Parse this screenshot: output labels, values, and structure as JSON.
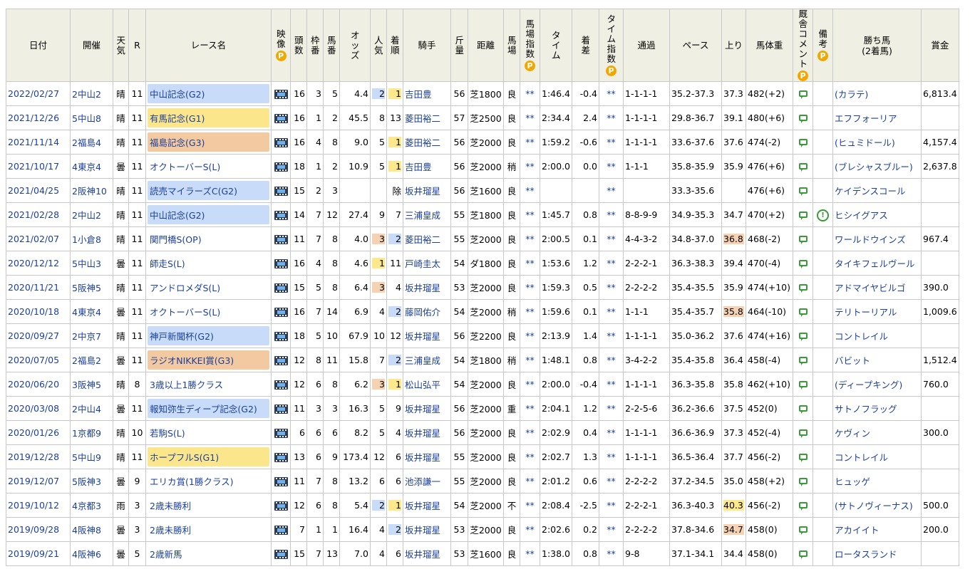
{
  "headers": {
    "date": "日付",
    "venue": "開催",
    "weather": "天気",
    "r": "R",
    "race_name": "レース名",
    "video": "映像",
    "field": "頭数",
    "frame": "枠番",
    "horse_no": "馬番",
    "odds": "オッズ",
    "pop": "人気",
    "rank": "着順",
    "jockey": "騎手",
    "weight": "斤量",
    "distance": "距離",
    "track": "馬場",
    "track_index": "馬場指数",
    "time": "タイム",
    "margin": "着差",
    "time_index": "タイム指数",
    "passing": "通過",
    "pace": "ペース",
    "last3f": "上り",
    "body_weight": "馬体重",
    "stable_comment": "厩舎コメント",
    "remarks": "備考",
    "winner": "勝ち馬",
    "winner_sub": "(2着馬)",
    "prize": "賞金",
    "premium_icon": "P"
  },
  "rows": [
    {
      "date": "2022/02/27",
      "venue": "2中山2",
      "weather": "晴",
      "r": "11",
      "race": "中山記念(G2)",
      "grade": "g2",
      "field": "16",
      "frame": "3",
      "horse_no": "5",
      "odds": "4.4",
      "pop": "2",
      "pop_hl": "blue",
      "rank": "1",
      "rank_hl": "yellow",
      "jockey": "吉田豊",
      "weight": "56",
      "distance": "芝1800",
      "track": "良",
      "track_index": "**",
      "time": "1:46.4",
      "margin": "-0.4",
      "time_index": "**",
      "passing": "1-1-1-1",
      "pace": "35.2-37.3",
      "last3f": "37.3",
      "last3f_hl": "",
      "body_weight": "482(+2)",
      "remark": "",
      "winner": "(カラテ)",
      "prize": "6,813.4"
    },
    {
      "date": "2021/12/26",
      "venue": "5中山8",
      "weather": "晴",
      "r": "11",
      "race": "有馬記念(G1)",
      "grade": "g1",
      "field": "16",
      "frame": "1",
      "horse_no": "2",
      "odds": "45.5",
      "pop": "8",
      "pop_hl": "",
      "rank": "13",
      "rank_hl": "",
      "jockey": "菱田裕二",
      "weight": "57",
      "distance": "芝2500",
      "track": "良",
      "track_index": "**",
      "time": "2:34.4",
      "margin": "2.4",
      "time_index": "**",
      "passing": "1-1-1-1",
      "pace": "29.8-36.7",
      "last3f": "39.1",
      "last3f_hl": "",
      "body_weight": "480(+6)",
      "remark": "",
      "winner": "エフフォーリア",
      "prize": ""
    },
    {
      "date": "2021/11/14",
      "venue": "2福島4",
      "weather": "晴",
      "r": "11",
      "race": "福島記念(G3)",
      "grade": "g3",
      "field": "16",
      "frame": "4",
      "horse_no": "8",
      "odds": "9.0",
      "pop": "5",
      "pop_hl": "",
      "rank": "1",
      "rank_hl": "yellow",
      "jockey": "菱田裕二",
      "weight": "56",
      "distance": "芝2000",
      "track": "良",
      "track_index": "**",
      "time": "1:59.2",
      "margin": "-0.6",
      "time_index": "**",
      "passing": "1-1-1-1",
      "pace": "33.6-37.6",
      "last3f": "37.6",
      "last3f_hl": "",
      "body_weight": "474(-2)",
      "remark": "",
      "winner": "(ヒュミドール)",
      "prize": "4,157.4"
    },
    {
      "date": "2021/10/17",
      "venue": "4東京4",
      "weather": "曇",
      "r": "11",
      "race": "オクトーバーS(L)",
      "grade": "",
      "field": "18",
      "frame": "1",
      "horse_no": "2",
      "odds": "10.9",
      "pop": "5",
      "pop_hl": "",
      "rank": "1",
      "rank_hl": "yellow",
      "jockey": "吉田豊",
      "weight": "56",
      "distance": "芝2000",
      "track": "稍",
      "track_index": "**",
      "time": "2:00.0",
      "margin": "0.0",
      "time_index": "**",
      "passing": "1-1-1",
      "pace": "35.8-35.9",
      "last3f": "35.9",
      "last3f_hl": "",
      "body_weight": "476(+6)",
      "remark": "",
      "winner": "(ブレシャスブルー)",
      "prize": "2,637.8"
    },
    {
      "date": "2021/04/25",
      "venue": "2阪神10",
      "weather": "晴",
      "r": "11",
      "race": "読売マイラーズC(G2)",
      "grade": "g2",
      "field": "15",
      "frame": "2",
      "horse_no": "3",
      "odds": "",
      "pop": "",
      "pop_hl": "",
      "rank": "除",
      "rank_hl": "",
      "jockey": "坂井瑠星",
      "weight": "56",
      "distance": "芝1600",
      "track": "良",
      "track_index": "**",
      "time": "",
      "margin": "",
      "time_index": "**",
      "passing": "",
      "pace": "33.3-35.6",
      "last3f": "",
      "last3f_hl": "",
      "body_weight": "476(+6)",
      "remark": "",
      "winner": "ケイデンスコール",
      "prize": ""
    },
    {
      "date": "2021/02/28",
      "venue": "2中山2",
      "weather": "晴",
      "r": "11",
      "race": "中山記念(G2)",
      "grade": "g2",
      "field": "14",
      "frame": "7",
      "horse_no": "12",
      "odds": "27.4",
      "pop": "9",
      "pop_hl": "",
      "rank": "7",
      "rank_hl": "",
      "jockey": "三浦皇成",
      "weight": "55",
      "distance": "芝1800",
      "track": "良",
      "track_index": "**",
      "time": "1:45.7",
      "margin": "0.8",
      "time_index": "**",
      "passing": "8-8-9-9",
      "pace": "34.9-35.3",
      "last3f": "34.7",
      "last3f_hl": "",
      "body_weight": "470(+2)",
      "remark": "!",
      "winner": "ヒシイグアス",
      "prize": ""
    },
    {
      "date": "2021/02/07",
      "venue": "1小倉8",
      "weather": "晴",
      "r": "11",
      "race": "関門橋S(OP)",
      "grade": "",
      "field": "11",
      "frame": "7",
      "horse_no": "8",
      "odds": "4.0",
      "pop": "3",
      "pop_hl": "orange",
      "rank": "2",
      "rank_hl": "blue",
      "jockey": "菱田裕二",
      "weight": "55",
      "distance": "芝2000",
      "track": "良",
      "track_index": "**",
      "time": "2:00.5",
      "margin": "0.1",
      "time_index": "**",
      "passing": "4-4-3-2",
      "pace": "34.8-37.0",
      "last3f": "36.8",
      "last3f_hl": "orange",
      "body_weight": "468(-2)",
      "remark": "",
      "winner": "ワールドウインズ",
      "prize": "967.4"
    },
    {
      "date": "2020/12/12",
      "venue": "5中山3",
      "weather": "曇",
      "r": "11",
      "race": "師走S(L)",
      "grade": "",
      "field": "16",
      "frame": "4",
      "horse_no": "8",
      "odds": "4.6",
      "pop": "1",
      "pop_hl": "yellow",
      "rank": "11",
      "rank_hl": "",
      "jockey": "戸崎圭太",
      "weight": "54",
      "distance": "ダ1800",
      "track": "良",
      "track_index": "**",
      "time": "1:53.6",
      "margin": "1.2",
      "time_index": "**",
      "passing": "2-2-2-1",
      "pace": "36.3-38.3",
      "last3f": "39.4",
      "last3f_hl": "",
      "body_weight": "470(-4)",
      "remark": "",
      "winner": "タイキフェルヴール",
      "prize": ""
    },
    {
      "date": "2020/11/21",
      "venue": "5阪神5",
      "weather": "晴",
      "r": "11",
      "race": "アンドロメダS(L)",
      "grade": "",
      "field": "15",
      "frame": "5",
      "horse_no": "8",
      "odds": "6.4",
      "pop": "3",
      "pop_hl": "orange",
      "rank": "4",
      "rank_hl": "",
      "jockey": "坂井瑠星",
      "weight": "53",
      "distance": "芝2000",
      "track": "良",
      "track_index": "**",
      "time": "1:59.3",
      "margin": "0.5",
      "time_index": "**",
      "passing": "2-2-2-2",
      "pace": "35.4-35.5",
      "last3f": "35.9",
      "last3f_hl": "",
      "body_weight": "474(+10)",
      "remark": "",
      "winner": "アドマイヤビルゴ",
      "prize": "390.0"
    },
    {
      "date": "2020/10/18",
      "venue": "4東京4",
      "weather": "曇",
      "r": "11",
      "race": "オクトーバーS(L)",
      "grade": "",
      "field": "16",
      "frame": "7",
      "horse_no": "14",
      "odds": "6.9",
      "pop": "4",
      "pop_hl": "",
      "rank": "2",
      "rank_hl": "blue",
      "jockey": "藤岡佑介",
      "weight": "54",
      "distance": "芝2000",
      "track": "稍",
      "track_index": "**",
      "time": "1:59.6",
      "margin": "0.1",
      "time_index": "**",
      "passing": "1-1-1",
      "pace": "35.4-35.7",
      "last3f": "35.8",
      "last3f_hl": "orange",
      "body_weight": "464(-10)",
      "remark": "",
      "winner": "テリトーリアル",
      "prize": "1,009.6"
    },
    {
      "date": "2020/09/27",
      "venue": "2中京7",
      "weather": "晴",
      "r": "11",
      "race": "神戸新聞杯(G2)",
      "grade": "g2",
      "field": "18",
      "frame": "5",
      "horse_no": "10",
      "odds": "67.9",
      "pop": "10",
      "pop_hl": "",
      "rank": "12",
      "rank_hl": "",
      "jockey": "坂井瑠星",
      "weight": "56",
      "distance": "芝2200",
      "track": "良",
      "track_index": "**",
      "time": "2:13.9",
      "margin": "1.4",
      "time_index": "**",
      "passing": "1-1-1-1",
      "pace": "35.0-36.2",
      "last3f": "37.6",
      "last3f_hl": "",
      "body_weight": "474(+16)",
      "remark": "",
      "winner": "コントレイル",
      "prize": ""
    },
    {
      "date": "2020/07/05",
      "venue": "2福島2",
      "weather": "曇",
      "r": "11",
      "race": "ラジオNIKKEI賞(G3)",
      "grade": "g3",
      "field": "12",
      "frame": "8",
      "horse_no": "11",
      "odds": "15.8",
      "pop": "7",
      "pop_hl": "",
      "rank": "2",
      "rank_hl": "blue",
      "jockey": "三浦皇成",
      "weight": "54",
      "distance": "芝1800",
      "track": "稍",
      "track_index": "**",
      "time": "1:48.1",
      "margin": "0.8",
      "time_index": "**",
      "passing": "3-4-2-2",
      "pace": "35.4-35.8",
      "last3f": "36.4",
      "last3f_hl": "",
      "body_weight": "458(-4)",
      "remark": "",
      "winner": "バビット",
      "prize": "1,512.4"
    },
    {
      "date": "2020/06/20",
      "venue": "3阪神5",
      "weather": "晴",
      "r": "8",
      "race": "3歳以上1勝クラス",
      "grade": "",
      "field": "12",
      "frame": "6",
      "horse_no": "8",
      "odds": "6.2",
      "pop": "3",
      "pop_hl": "orange",
      "rank": "1",
      "rank_hl": "yellow",
      "jockey": "松山弘平",
      "weight": "54",
      "distance": "芝2000",
      "track": "良",
      "track_index": "**",
      "time": "2:00.0",
      "margin": "-0.4",
      "time_index": "**",
      "passing": "1-1-1-1",
      "pace": "36.3-35.8",
      "last3f": "35.8",
      "last3f_hl": "",
      "body_weight": "462(+10)",
      "remark": "",
      "winner": "(ディープキング)",
      "prize": "760.0"
    },
    {
      "date": "2020/03/08",
      "venue": "2中山4",
      "weather": "曇",
      "r": "11",
      "race": "報知弥生ディープ記念(G2)",
      "grade": "g2",
      "field": "11",
      "frame": "3",
      "horse_no": "3",
      "odds": "16.3",
      "pop": "5",
      "pop_hl": "",
      "rank": "9",
      "rank_hl": "",
      "jockey": "坂井瑠星",
      "weight": "56",
      "distance": "芝2000",
      "track": "重",
      "track_index": "**",
      "time": "2:04.1",
      "margin": "1.2",
      "time_index": "**",
      "passing": "2-2-5-6",
      "pace": "36.2-36.6",
      "last3f": "37.5",
      "last3f_hl": "",
      "body_weight": "452(0)",
      "remark": "",
      "winner": "サトノフラッグ",
      "prize": ""
    },
    {
      "date": "2020/01/26",
      "venue": "1京都9",
      "weather": "晴",
      "r": "10",
      "race": "若駒S(L)",
      "grade": "",
      "field": "6",
      "frame": "6",
      "horse_no": "6",
      "odds": "8.2",
      "pop": "5",
      "pop_hl": "",
      "rank": "4",
      "rank_hl": "",
      "jockey": "坂井瑠星",
      "weight": "56",
      "distance": "芝2000",
      "track": "良",
      "track_index": "**",
      "time": "2:02.9",
      "margin": "0.4",
      "time_index": "**",
      "passing": "1-1-1-1",
      "pace": "36.6-36.9",
      "last3f": "37.3",
      "last3f_hl": "",
      "body_weight": "452(-4)",
      "remark": "",
      "winner": "ケヴィン",
      "prize": "300.0"
    },
    {
      "date": "2019/12/28",
      "venue": "5中山9",
      "weather": "晴",
      "r": "11",
      "race": "ホープフルS(G1)",
      "grade": "g1",
      "field": "13",
      "frame": "6",
      "horse_no": "9",
      "odds": "173.4",
      "pop": "12",
      "pop_hl": "",
      "rank": "6",
      "rank_hl": "",
      "jockey": "坂井瑠星",
      "weight": "55",
      "distance": "芝2000",
      "track": "良",
      "track_index": "**",
      "time": "2:02.7",
      "margin": "1.3",
      "time_index": "**",
      "passing": "1-1-1-1",
      "pace": "36.5-36.4",
      "last3f": "37.7",
      "last3f_hl": "",
      "body_weight": "456(-2)",
      "remark": "",
      "winner": "コントレイル",
      "prize": ""
    },
    {
      "date": "2019/12/07",
      "venue": "5阪神3",
      "weather": "曇",
      "r": "9",
      "race": "エリカ賞(1勝クラス)",
      "grade": "",
      "field": "11",
      "frame": "7",
      "horse_no": "8",
      "odds": "13.2",
      "pop": "6",
      "pop_hl": "",
      "rank": "6",
      "rank_hl": "",
      "jockey": "池添謙一",
      "weight": "55",
      "distance": "芝2000",
      "track": "良",
      "track_index": "**",
      "time": "2:01.2",
      "margin": "0.6",
      "time_index": "**",
      "passing": "2-2-2-2",
      "pace": "37.2-34.5",
      "last3f": "35.0",
      "last3f_hl": "",
      "body_weight": "458(+2)",
      "remark": "",
      "winner": "ヒュッゲ",
      "prize": ""
    },
    {
      "date": "2019/10/12",
      "venue": "4京都3",
      "weather": "雨",
      "r": "3",
      "race": "2歳未勝利",
      "grade": "",
      "field": "12",
      "frame": "6",
      "horse_no": "8",
      "odds": "5.4",
      "pop": "2",
      "pop_hl": "blue",
      "rank": "1",
      "rank_hl": "yellow",
      "jockey": "坂井瑠星",
      "weight": "54",
      "distance": "芝2000",
      "track": "不",
      "track_index": "**",
      "time": "2:08.4",
      "margin": "-2.5",
      "time_index": "**",
      "passing": "2-2-2-1",
      "pace": "36.3-40.3",
      "last3f": "40.3",
      "last3f_hl": "yellow",
      "body_weight": "456(-2)",
      "remark": "",
      "winner": "(サトノヴィーナス)",
      "prize": "500.0"
    },
    {
      "date": "2019/09/28",
      "venue": "4阪神8",
      "weather": "曇",
      "r": "3",
      "race": "2歳未勝利",
      "grade": "",
      "field": "7",
      "frame": "1",
      "horse_no": "1",
      "odds": "16.4",
      "pop": "4",
      "pop_hl": "",
      "rank": "2",
      "rank_hl": "blue",
      "jockey": "坂井瑠星",
      "weight": "53",
      "distance": "芝2000",
      "track": "良",
      "track_index": "**",
      "time": "2:02.6",
      "margin": "0.2",
      "time_index": "**",
      "passing": "2-2-2-2",
      "pace": "37.8-34.6",
      "last3f": "34.7",
      "last3f_hl": "orange",
      "body_weight": "458(0)",
      "remark": "",
      "winner": "アカイイト",
      "prize": "200.0"
    },
    {
      "date": "2019/09/21",
      "venue": "4阪神6",
      "weather": "曇",
      "r": "5",
      "race": "2歳新馬",
      "grade": "",
      "field": "15",
      "frame": "7",
      "horse_no": "13",
      "odds": "7.0",
      "pop": "4",
      "pop_hl": "",
      "rank": "6",
      "rank_hl": "",
      "jockey": "坂井瑠星",
      "weight": "53",
      "distance": "芝1600",
      "track": "良",
      "track_index": "**",
      "time": "1:38.0",
      "margin": "0.8",
      "time_index": "**",
      "passing": "9-8",
      "pace": "37.1-34.1",
      "last3f": "34.4",
      "last3f_hl": "",
      "body_weight": "458(0)",
      "remark": "",
      "winner": "ロータスランド",
      "prize": ""
    }
  ]
}
